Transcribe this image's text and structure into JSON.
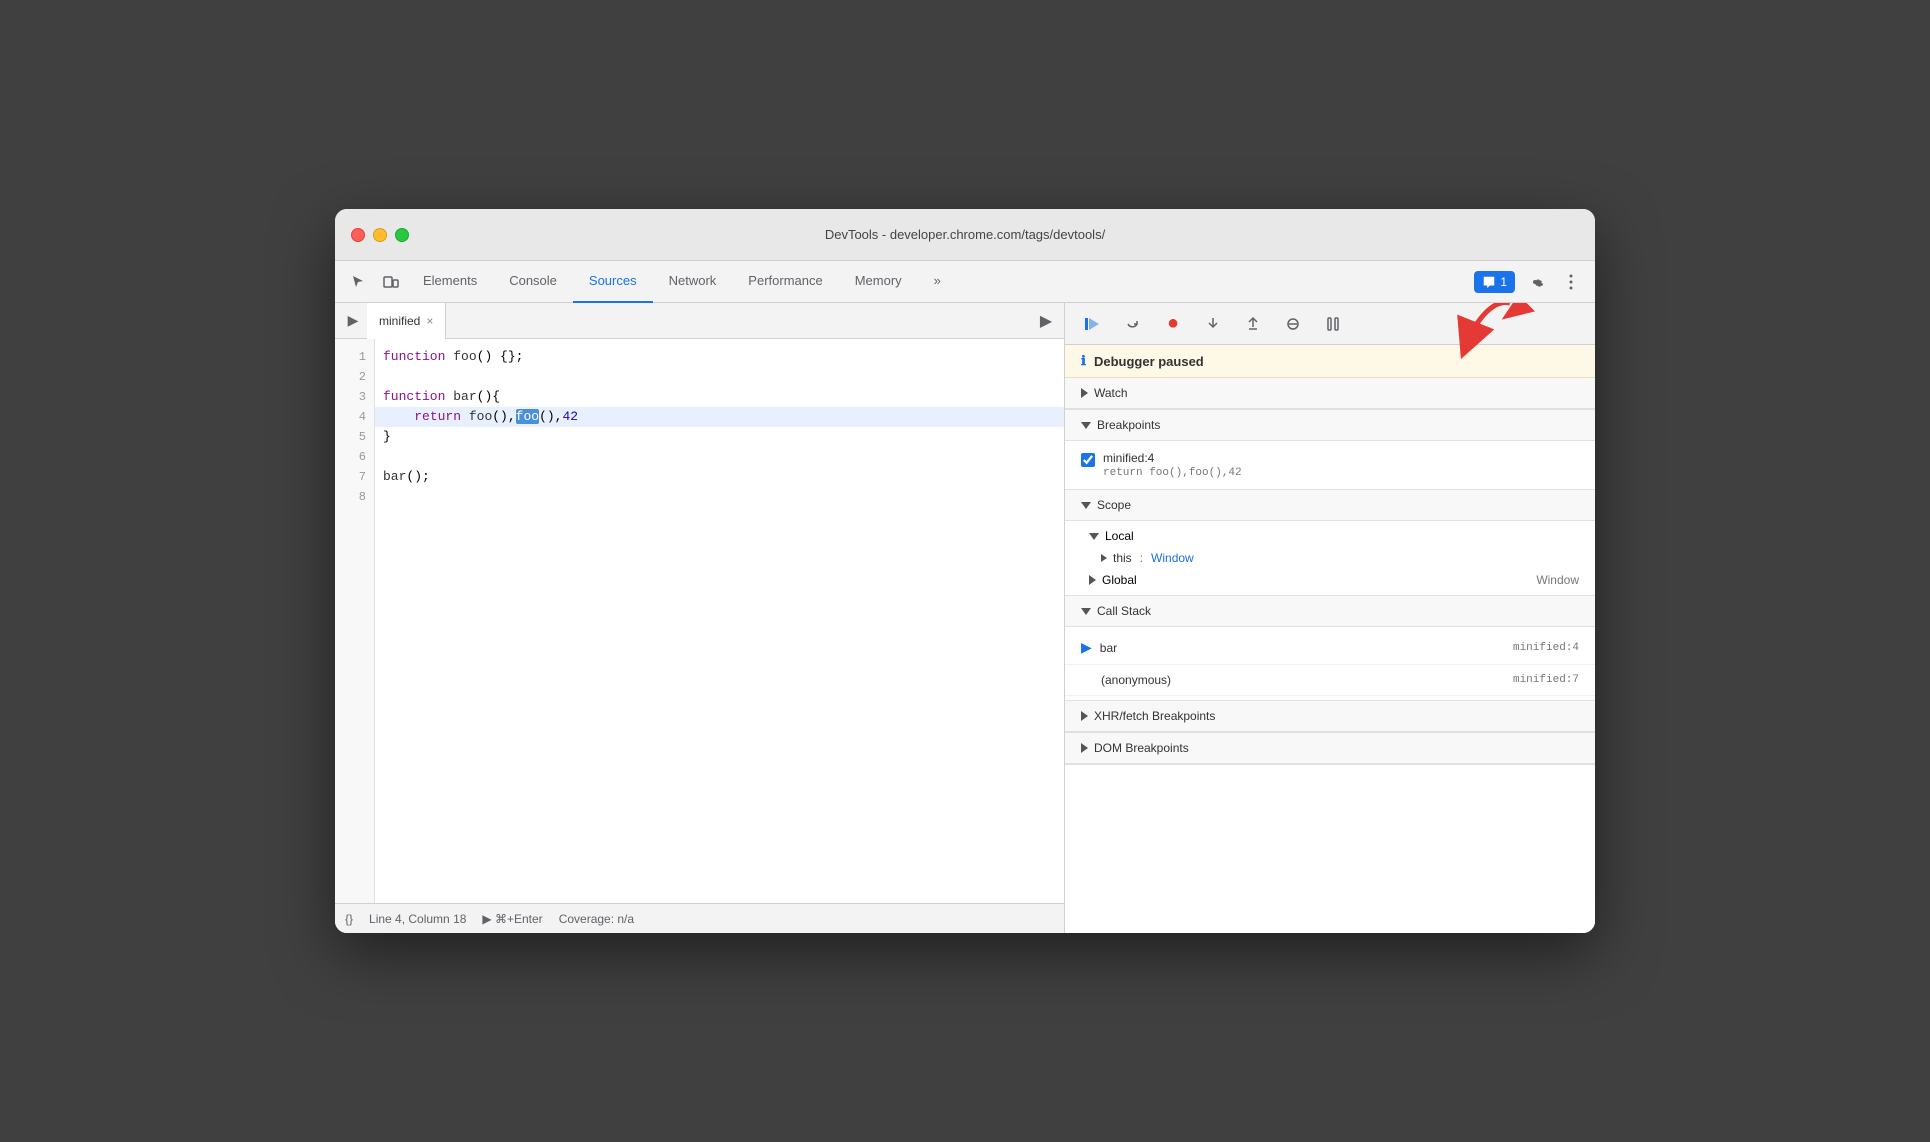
{
  "window": {
    "title": "DevTools - developer.chrome.com/tags/devtools/"
  },
  "tabs": {
    "items": [
      "Elements",
      "Console",
      "Sources",
      "Network",
      "Performance",
      "Memory"
    ],
    "active": "Sources",
    "more_label": "»"
  },
  "toolbar_right": {
    "message_badge": "1",
    "settings_icon": "gear-icon",
    "more_icon": "more-icon"
  },
  "file_panel": {
    "tab_name": "minified",
    "close_label": "×",
    "run_icon": "▶"
  },
  "code": {
    "lines": [
      {
        "num": 1,
        "content": "function foo() {};"
      },
      {
        "num": 2,
        "content": ""
      },
      {
        "num": 3,
        "content": "function bar(){"
      },
      {
        "num": 4,
        "content": "    return foo(),foo(),42",
        "highlighted": true
      },
      {
        "num": 5,
        "content": "}"
      },
      {
        "num": 6,
        "content": ""
      },
      {
        "num": 7,
        "content": "bar();"
      },
      {
        "num": 8,
        "content": ""
      }
    ]
  },
  "status_bar": {
    "line_col": "Line 4, Column 18",
    "run_label": "⌘+Enter",
    "coverage": "Coverage: n/a",
    "format_icon": "{}"
  },
  "debugger": {
    "paused_message": "Debugger paused",
    "sections": {
      "watch": {
        "label": "Watch",
        "collapsed": true
      },
      "breakpoints": {
        "label": "Breakpoints",
        "collapsed": false,
        "items": [
          {
            "location": "minified:4",
            "code": "return foo(),foo(),42"
          }
        ]
      },
      "scope": {
        "label": "Scope",
        "collapsed": false,
        "local": {
          "label": "Local",
          "items": [
            {
              "key": "this",
              "value": "Window"
            }
          ]
        },
        "global": {
          "label": "Global",
          "value": "Window"
        }
      },
      "call_stack": {
        "label": "Call Stack",
        "collapsed": false,
        "items": [
          {
            "name": "bar",
            "location": "minified:4",
            "current": true
          },
          {
            "name": "(anonymous)",
            "location": "minified:7",
            "current": false
          }
        ]
      },
      "xhr": {
        "label": "XHR/fetch Breakpoints",
        "collapsed": true
      },
      "dom": {
        "label": "DOM Breakpoints",
        "collapsed": true
      }
    }
  }
}
